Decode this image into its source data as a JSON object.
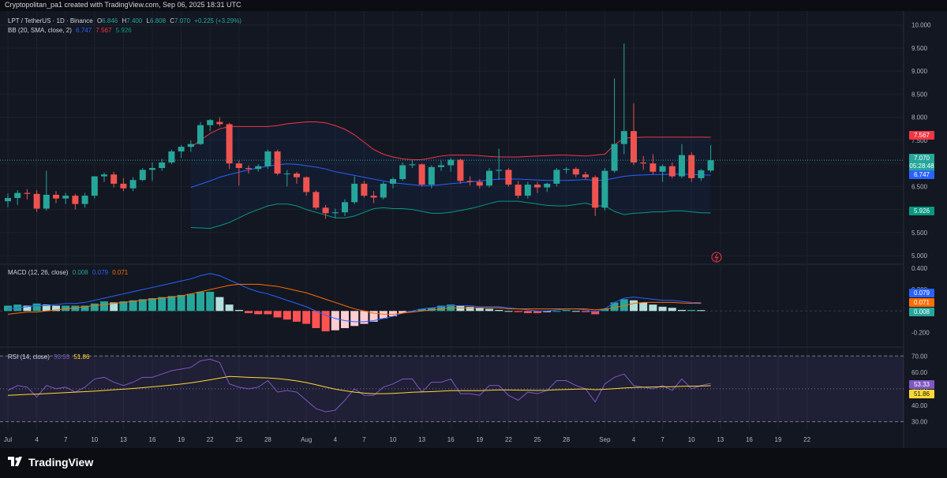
{
  "header": {
    "credit": "Cryptopolitan_pa1 created with TradingView.com, Sep 06, 2025 18:31 UTC"
  },
  "legend": {
    "symbol": "LPT / TetherUS · 1D · Binance",
    "o_label": "O",
    "o": "6.846",
    "h_label": "H",
    "h": "7.400",
    "l_label": "L",
    "l": "6.808",
    "c_label": "C",
    "c": "7.070",
    "change": "+0.225 (+3.29%)",
    "bb_label": "BB (20, SMA, close, 2)",
    "bb_basis": "6.747",
    "bb_upper": "7.567",
    "bb_lower": "5.926"
  },
  "macd_legend": {
    "label": "MACD (12, 26, close)",
    "hist": "0.008",
    "macd": "0.079",
    "signal": "0.071"
  },
  "rsi_legend": {
    "label": "RSI (14, close)",
    "rsi": "53.33",
    "ma": "51.86"
  },
  "price_badges": {
    "upper": "7.567",
    "last": "7.070",
    "countdown": "05:28:48",
    "basis": "6.747",
    "lower": "5.926"
  },
  "macd_badges": {
    "macd": "0.079",
    "signal": "0.071",
    "hist": "0.008"
  },
  "rsi_badges": {
    "rsi": "53.33",
    "ma": "51.86"
  },
  "footer": {
    "brand": "TradingView"
  },
  "colors": {
    "up": "#26a69a",
    "down": "#ef5350",
    "bb_basis": "#2962ff",
    "bb_upper": "#f23645",
    "bb_lower": "#089981",
    "macd": "#2962ff",
    "signal": "#ff6d00",
    "rsi": "#7e57c2",
    "rsi_ma": "#fdd835"
  },
  "chart_data": [
    {
      "type": "candlestick",
      "title": "LPT / TetherUS · 1D · Binance",
      "ylim": [
        4.9,
        10.2
      ],
      "yticks": [
        "10.000",
        "9.500",
        "9.000",
        "8.500",
        "8.000",
        "7.500",
        "7.000",
        "6.500",
        "6.000",
        "5.500",
        "5.000"
      ],
      "x_ticks": [
        "Jul",
        "4",
        "7",
        "10",
        "13",
        "16",
        "19",
        "22",
        "25",
        "28",
        "Aug",
        "4",
        "7",
        "10",
        "13",
        "16",
        "19",
        "22",
        "25",
        "28",
        "Sep",
        "4",
        "7",
        "10",
        "13",
        "16",
        "19",
        "22"
      ],
      "x_tick_days": [
        0,
        3,
        6,
        9,
        12,
        15,
        18,
        21,
        24,
        27,
        31,
        34,
        37,
        40,
        43,
        46,
        49,
        52,
        55,
        58,
        62,
        65,
        68,
        71,
        74,
        77,
        80,
        83
      ],
      "candles": [
        [
          6.18,
          6.35,
          6.05,
          6.25
        ],
        [
          6.25,
          6.42,
          6.1,
          6.36
        ],
        [
          6.36,
          6.44,
          6.22,
          6.34
        ],
        [
          6.34,
          6.42,
          5.95,
          6.02
        ],
        [
          6.02,
          6.84,
          5.98,
          6.32
        ],
        [
          6.32,
          6.4,
          6.14,
          6.24
        ],
        [
          6.24,
          6.36,
          6.12,
          6.3
        ],
        [
          6.3,
          6.34,
          6.0,
          6.12
        ],
        [
          6.12,
          6.36,
          6.04,
          6.3
        ],
        [
          6.3,
          6.72,
          6.24,
          6.72
        ],
        [
          6.72,
          6.8,
          6.6,
          6.76
        ],
        [
          6.76,
          6.82,
          6.48,
          6.56
        ],
        [
          6.56,
          6.68,
          6.4,
          6.46
        ],
        [
          6.46,
          6.7,
          6.4,
          6.64
        ],
        [
          6.64,
          6.9,
          6.62,
          6.86
        ],
        [
          6.86,
          7.02,
          6.62,
          6.9
        ],
        [
          6.9,
          7.1,
          6.84,
          7.02
        ],
        [
          7.02,
          7.3,
          6.98,
          7.26
        ],
        [
          7.26,
          7.4,
          7.12,
          7.36
        ],
        [
          7.36,
          7.5,
          7.25,
          7.42
        ],
        [
          7.42,
          7.9,
          7.4,
          7.83
        ],
        [
          7.83,
          7.96,
          7.7,
          7.94
        ],
        [
          7.9,
          8.0,
          7.8,
          7.85
        ],
        [
          7.85,
          7.88,
          6.88,
          7.0
        ],
        [
          7.0,
          7.06,
          6.52,
          6.9
        ],
        [
          6.9,
          6.96,
          6.78,
          6.88
        ],
        [
          6.88,
          6.98,
          6.82,
          6.94
        ],
        [
          6.94,
          7.3,
          6.88,
          7.26
        ],
        [
          7.26,
          7.3,
          6.74,
          6.78
        ],
        [
          6.78,
          6.86,
          6.5,
          6.78
        ],
        [
          6.78,
          6.82,
          6.56,
          6.7
        ],
        [
          6.7,
          6.72,
          6.3,
          6.38
        ],
        [
          6.38,
          6.42,
          6.0,
          6.04
        ],
        [
          6.04,
          6.1,
          5.8,
          5.92
        ],
        [
          5.92,
          6.02,
          5.82,
          5.94
        ],
        [
          5.94,
          6.22,
          5.86,
          6.16
        ],
        [
          6.16,
          6.72,
          6.12,
          6.56
        ],
        [
          6.56,
          6.62,
          6.26,
          6.3
        ],
        [
          6.3,
          6.4,
          6.14,
          6.26
        ],
        [
          6.26,
          6.6,
          6.22,
          6.56
        ],
        [
          6.56,
          6.7,
          6.46,
          6.66
        ],
        [
          6.66,
          7.02,
          6.62,
          6.96
        ],
        [
          6.96,
          7.08,
          6.9,
          6.98
        ],
        [
          6.98,
          7.0,
          6.5,
          6.54
        ],
        [
          6.54,
          6.96,
          6.46,
          6.92
        ],
        [
          6.92,
          7.06,
          6.84,
          6.96
        ],
        [
          6.96,
          7.12,
          6.82,
          7.08
        ],
        [
          7.08,
          7.1,
          6.56,
          6.62
        ],
        [
          6.62,
          6.72,
          6.52,
          6.6
        ],
        [
          6.6,
          6.66,
          6.46,
          6.52
        ],
        [
          6.52,
          6.9,
          6.48,
          6.84
        ],
        [
          6.84,
          7.32,
          6.64,
          6.86
        ],
        [
          6.86,
          6.9,
          6.5,
          6.54
        ],
        [
          6.54,
          6.62,
          6.24,
          6.3
        ],
        [
          6.3,
          6.6,
          6.24,
          6.54
        ],
        [
          6.54,
          6.6,
          6.36,
          6.48
        ],
        [
          6.48,
          6.58,
          6.38,
          6.56
        ],
        [
          6.56,
          6.9,
          6.5,
          6.86
        ],
        [
          6.86,
          6.92,
          6.78,
          6.88
        ],
        [
          6.88,
          6.92,
          6.7,
          6.76
        ],
        [
          6.76,
          6.82,
          6.66,
          6.7
        ],
        [
          6.7,
          6.74,
          5.86,
          6.04
        ],
        [
          6.04,
          6.9,
          5.98,
          6.84
        ],
        [
          6.84,
          8.84,
          6.8,
          7.42
        ],
        [
          7.42,
          9.6,
          7.2,
          7.7
        ],
        [
          7.7,
          8.3,
          6.96,
          7.02
        ],
        [
          7.02,
          7.16,
          6.86,
          7.0
        ],
        [
          7.0,
          7.2,
          6.76,
          6.82
        ],
        [
          6.82,
          6.98,
          6.6,
          6.94
        ],
        [
          6.94,
          7.02,
          6.68,
          6.72
        ],
        [
          6.72,
          7.42,
          6.68,
          7.18
        ],
        [
          7.18,
          7.24,
          6.6,
          6.68
        ],
        [
          6.68,
          6.88,
          6.62,
          6.85
        ],
        [
          6.846,
          7.4,
          6.808,
          7.07
        ]
      ],
      "bb_basis": [
        null,
        null,
        null,
        null,
        null,
        null,
        null,
        null,
        null,
        null,
        null,
        null,
        null,
        null,
        null,
        null,
        null,
        null,
        null,
        6.48,
        6.55,
        6.62,
        6.7,
        6.76,
        6.81,
        6.86,
        6.9,
        6.94,
        6.97,
        6.99,
        6.98,
        6.95,
        6.92,
        6.88,
        6.82,
        6.78,
        6.74,
        6.7,
        6.66,
        6.62,
        6.58,
        6.56,
        6.54,
        6.52,
        6.52,
        6.54,
        6.56,
        6.58,
        6.6,
        6.62,
        6.64,
        6.66,
        6.66,
        6.66,
        6.65,
        6.64,
        6.63,
        6.63,
        6.63,
        6.64,
        6.65,
        6.63,
        6.64,
        6.68,
        6.72,
        6.74,
        6.75,
        6.76,
        6.76,
        6.77,
        6.77,
        6.76,
        6.75,
        6.747
      ],
      "bb_upper": [
        null,
        null,
        null,
        null,
        null,
        null,
        null,
        null,
        null,
        null,
        null,
        null,
        null,
        null,
        null,
        null,
        null,
        null,
        null,
        7.35,
        7.5,
        7.65,
        7.75,
        7.8,
        7.8,
        7.8,
        7.8,
        7.8,
        7.82,
        7.86,
        7.88,
        7.9,
        7.9,
        7.88,
        7.82,
        7.74,
        7.62,
        7.46,
        7.3,
        7.2,
        7.14,
        7.1,
        7.08,
        7.08,
        7.12,
        7.16,
        7.18,
        7.18,
        7.18,
        7.17,
        7.15,
        7.14,
        7.14,
        7.14,
        7.15,
        7.16,
        7.17,
        7.18,
        7.18,
        7.17,
        7.16,
        7.18,
        7.2,
        7.4,
        7.55,
        7.56,
        7.57,
        7.57,
        7.57,
        7.57,
        7.57,
        7.57,
        7.57,
        7.567
      ],
      "bb_lower": [
        null,
        null,
        null,
        null,
        null,
        null,
        null,
        null,
        null,
        null,
        null,
        null,
        null,
        null,
        null,
        null,
        null,
        null,
        null,
        5.61,
        5.6,
        5.59,
        5.65,
        5.72,
        5.82,
        5.92,
        6.0,
        6.08,
        6.12,
        6.12,
        6.08,
        6.0,
        5.94,
        5.88,
        5.82,
        5.82,
        5.86,
        5.94,
        6.02,
        6.04,
        6.02,
        6.02,
        6.0,
        5.96,
        5.92,
        5.92,
        5.94,
        5.98,
        6.02,
        6.07,
        6.13,
        6.18,
        6.18,
        6.18,
        6.15,
        6.12,
        6.09,
        6.08,
        6.08,
        6.11,
        6.14,
        6.08,
        6.08,
        5.96,
        5.89,
        5.92,
        5.93,
        5.95,
        5.95,
        5.97,
        5.97,
        5.95,
        5.93,
        5.926
      ]
    },
    {
      "type": "bar",
      "title": "MACD (12, 26, close)",
      "ylim": [
        -0.3,
        0.4
      ],
      "yticks": [
        "0.400",
        "0.200",
        "-0.200"
      ],
      "histogram": [
        0.05,
        0.06,
        0.05,
        0.07,
        0.06,
        0.05,
        0.05,
        0.05,
        0.05,
        0.07,
        0.09,
        0.08,
        0.09,
        0.1,
        0.11,
        0.12,
        0.13,
        0.14,
        0.15,
        0.16,
        0.18,
        0.18,
        0.13,
        0.06,
        0.01,
        -0.02,
        -0.03,
        -0.03,
        -0.06,
        -0.08,
        -0.1,
        -0.12,
        -0.16,
        -0.19,
        -0.18,
        -0.16,
        -0.14,
        -0.12,
        -0.1,
        -0.07,
        -0.05,
        -0.02,
        0.0,
        0.02,
        0.03,
        0.05,
        0.06,
        0.05,
        0.04,
        0.03,
        0.02,
        0.01,
        0.0,
        -0.01,
        -0.02,
        -0.02,
        -0.01,
        0.0,
        0.01,
        0.0,
        -0.01,
        -0.03,
        0.02,
        0.08,
        0.11,
        0.1,
        0.08,
        0.06,
        0.04,
        0.03,
        0.01,
        0.01,
        0.008
      ],
      "macd": [
        0.02,
        0.03,
        0.04,
        0.05,
        0.05,
        0.06,
        0.07,
        0.07,
        0.08,
        0.1,
        0.12,
        0.14,
        0.16,
        0.18,
        0.2,
        0.22,
        0.24,
        0.26,
        0.28,
        0.3,
        0.33,
        0.35,
        0.33,
        0.29,
        0.25,
        0.21,
        0.18,
        0.16,
        0.13,
        0.1,
        0.07,
        0.04,
        0.0,
        -0.04,
        -0.07,
        -0.09,
        -0.1,
        -0.1,
        -0.09,
        -0.07,
        -0.05,
        -0.02,
        0.0,
        0.02,
        0.03,
        0.04,
        0.05,
        0.05,
        0.05,
        0.04,
        0.04,
        0.04,
        0.03,
        0.02,
        0.01,
        0.0,
        0.0,
        0.01,
        0.02,
        0.02,
        0.01,
        -0.01,
        0.02,
        0.08,
        0.12,
        0.13,
        0.12,
        0.11,
        0.1,
        0.1,
        0.09,
        0.08,
        0.079
      ],
      "signal": [
        -0.03,
        -0.02,
        -0.01,
        -0.01,
        0.0,
        0.01,
        0.02,
        0.03,
        0.04,
        0.05,
        0.06,
        0.07,
        0.08,
        0.09,
        0.1,
        0.11,
        0.12,
        0.13,
        0.14,
        0.16,
        0.18,
        0.2,
        0.22,
        0.24,
        0.25,
        0.25,
        0.25,
        0.24,
        0.23,
        0.21,
        0.19,
        0.17,
        0.14,
        0.11,
        0.08,
        0.05,
        0.02,
        0.0,
        -0.02,
        -0.03,
        -0.03,
        -0.02,
        -0.01,
        0.0,
        0.01,
        0.02,
        0.03,
        0.03,
        0.03,
        0.03,
        0.03,
        0.03,
        0.02,
        0.02,
        0.02,
        0.02,
        0.02,
        0.02,
        0.02,
        0.02,
        0.02,
        0.01,
        0.02,
        0.03,
        0.05,
        0.07,
        0.08,
        0.08,
        0.08,
        0.08,
        0.075,
        0.072,
        0.071
      ]
    },
    {
      "type": "line",
      "title": "RSI (14, close)",
      "ylim": [
        25,
        73
      ],
      "yticks": [
        "70.00",
        "60.00",
        "50.00",
        "40.00",
        "30.00"
      ],
      "rsi": [
        49,
        52,
        51,
        45,
        52,
        50,
        51,
        48,
        51,
        56,
        57,
        54,
        52,
        54,
        57,
        57,
        59,
        61,
        62,
        63,
        67,
        68,
        66,
        53,
        51,
        50,
        51,
        55,
        48,
        49,
        48,
        43,
        38,
        36,
        37,
        43,
        50,
        46,
        46,
        51,
        53,
        56,
        56,
        48,
        54,
        54,
        56,
        47,
        47,
        46,
        52,
        52,
        46,
        43,
        48,
        47,
        49,
        55,
        55,
        52,
        50,
        42,
        53,
        57,
        59,
        52,
        51,
        50,
        52,
        49,
        56,
        50,
        52,
        53.33
      ],
      "rsi_ma": [
        46,
        46.3,
        46.6,
        46.8,
        47.1,
        47.4,
        47.7,
        48.0,
        48.3,
        48.6,
        49.0,
        49.4,
        49.8,
        50.2,
        50.7,
        51.2,
        51.7,
        52.3,
        52.9,
        53.6,
        54.5,
        55.5,
        56.5,
        57.5,
        57.3,
        57.0,
        56.8,
        56.6,
        56.2,
        55.6,
        54.8,
        53.8,
        52.5,
        51.1,
        49.8,
        48.8,
        48.0,
        47.4,
        47.0,
        47.0,
        47.2,
        47.5,
        47.9,
        48.1,
        48.3,
        48.6,
        48.9,
        48.9,
        48.9,
        48.9,
        49.1,
        49.3,
        49.3,
        49.2,
        49.1,
        49.0,
        49.1,
        49.4,
        49.6,
        49.8,
        49.9,
        49.5,
        49.7,
        50.1,
        50.5,
        50.8,
        51.0,
        51.1,
        51.2,
        51.3,
        51.5,
        51.6,
        51.7,
        51.86
      ]
    }
  ]
}
